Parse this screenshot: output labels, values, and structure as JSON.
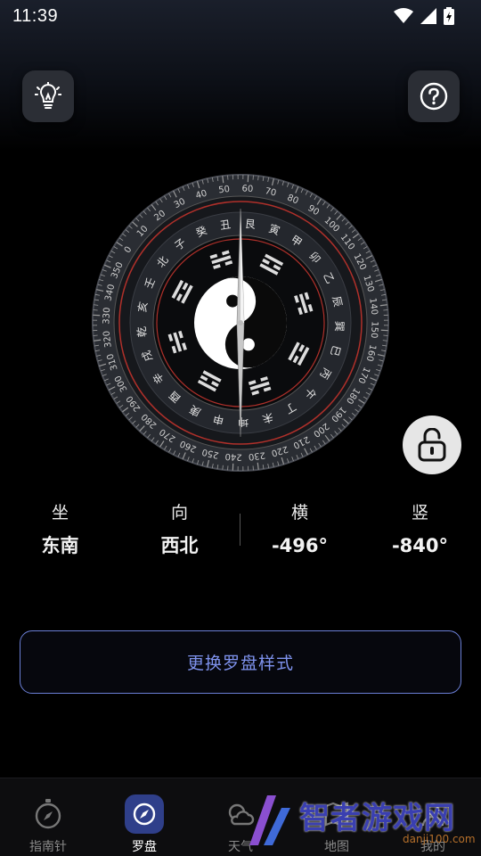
{
  "status_bar": {
    "time": "11:39"
  },
  "compass": {
    "degree_ticks": [
      "0",
      "10",
      "20",
      "30",
      "40",
      "50",
      "60",
      "70",
      "80",
      "90",
      "100",
      "110",
      "120",
      "130",
      "140",
      "150",
      "160",
      "170",
      "180",
      "190",
      "200",
      "210",
      "220",
      "230",
      "240",
      "250",
      "260",
      "270",
      "280",
      "290",
      "300",
      "310",
      "320",
      "330",
      "340",
      "350"
    ],
    "mountains": [
      "北",
      "子",
      "癸",
      "丑",
      "艮",
      "寅",
      "甲",
      "卯",
      "乙",
      "辰",
      "巽",
      "巳",
      "丙",
      "午",
      "丁",
      "未",
      "坤",
      "申",
      "庚",
      "酉",
      "辛",
      "戌",
      "乾",
      "亥",
      "壬"
    ],
    "direction_labels": {
      "north": "北",
      "east": "东",
      "south": "南",
      "west": "西"
    },
    "colors": {
      "ring": "#3a3d44",
      "red_ring": "#b0302a",
      "needle": "#c8c8c8"
    }
  },
  "readout": {
    "sit_label": "坐",
    "sit_value": "东南",
    "face_label": "向",
    "face_value": "西北",
    "horizontal_label": "横",
    "horizontal_value": "-496°",
    "vertical_label": "竖",
    "vertical_value": "-840°"
  },
  "actions": {
    "change_style": "更换罗盘样式"
  },
  "nav": [
    {
      "label": "指南针",
      "icon": "compass-icon"
    },
    {
      "label": "罗盘",
      "icon": "luopan-icon"
    },
    {
      "label": "天气",
      "icon": "weather-icon"
    },
    {
      "label": "地图",
      "icon": "map-icon"
    },
    {
      "label": "我的",
      "icon": "profile-icon"
    }
  ],
  "watermark": {
    "main": "智者游戏网",
    "sub": "danji100.com"
  },
  "icons": {
    "light": "lightbulb-icon",
    "help": "help-icon",
    "lock": "lock-icon"
  }
}
